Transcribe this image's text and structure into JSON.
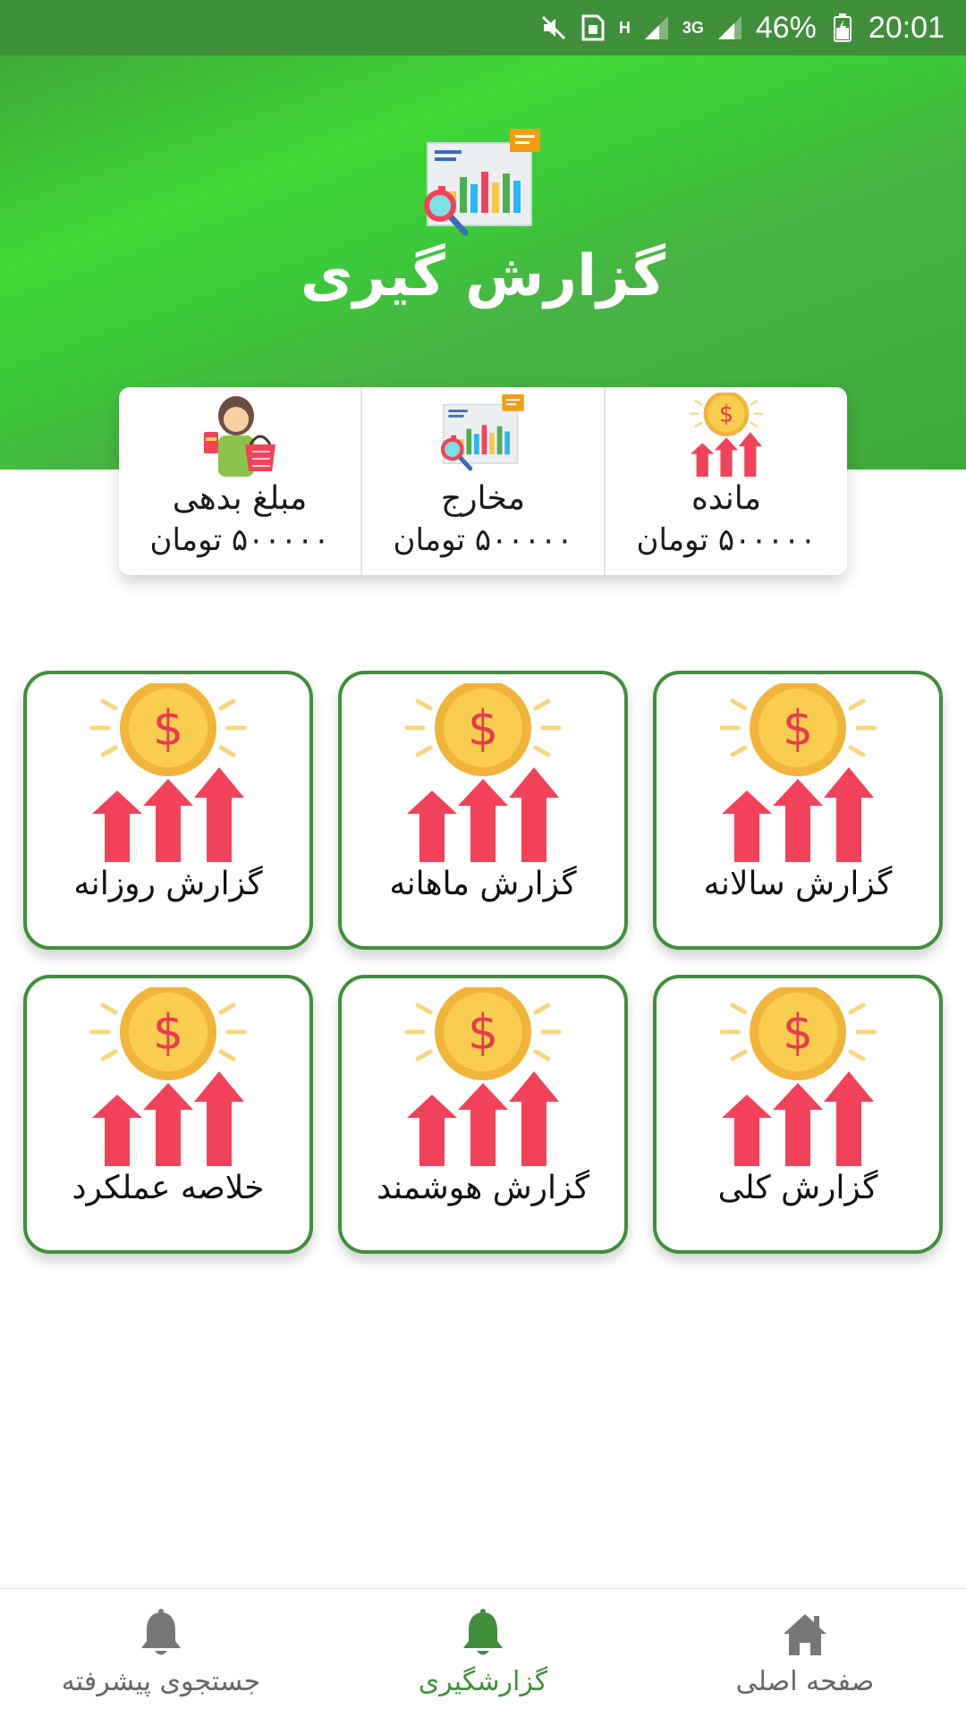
{
  "status_bar": {
    "network_h": "H",
    "network_3g": "3G",
    "battery": "46%",
    "time": "20:01"
  },
  "header": {
    "title": "گزارش گیری"
  },
  "summary": [
    {
      "label": "مانده",
      "value": "۵۰۰۰۰۰ تومان",
      "icon": "coin-arrows-icon"
    },
    {
      "label": "مخارج",
      "value": "۵۰۰۰۰۰ تومان",
      "icon": "report-chart-icon"
    },
    {
      "label": "مبلغ بدهی",
      "value": "۵۰۰۰۰۰ تومان",
      "icon": "shopper-icon"
    }
  ],
  "tiles": [
    {
      "label": "گزارش سالانه"
    },
    {
      "label": "گزارش ماهانه"
    },
    {
      "label": "گزارش روزانه"
    },
    {
      "label": "گزارش کلی"
    },
    {
      "label": "گزارش هوشمند"
    },
    {
      "label": "خلاصه عملکرد"
    }
  ],
  "bottom_nav": [
    {
      "label": "صفحه اصلی",
      "icon": "home-icon",
      "active": false
    },
    {
      "label": "گزارشگیری",
      "icon": "bell-icon",
      "active": true
    },
    {
      "label": "جستجوی پیشرفته",
      "icon": "bell-icon",
      "active": false
    }
  ],
  "colors": {
    "primary_green": "#3f8f3a",
    "coin": "#f6c744",
    "arrow_red": "#f2425a"
  }
}
